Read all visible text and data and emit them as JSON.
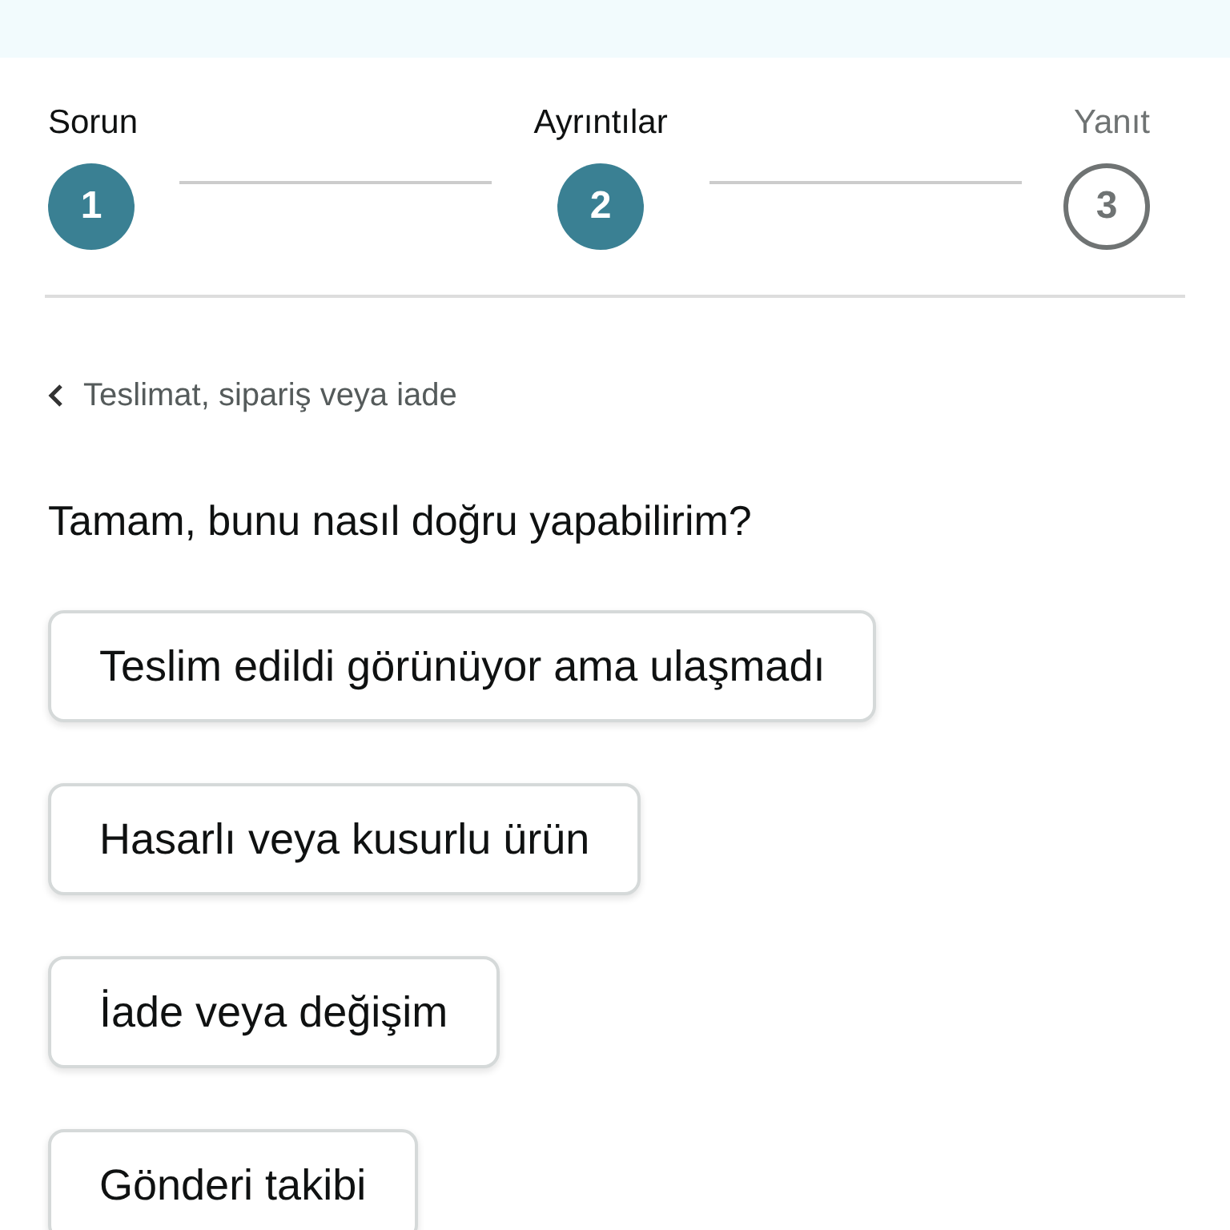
{
  "steps": [
    {
      "label": "Sorun",
      "number": "1",
      "active": true
    },
    {
      "label": "Ayrıntılar",
      "number": "2",
      "active": true
    },
    {
      "label": "Yanıt",
      "number": "3",
      "active": false
    }
  ],
  "back_link": {
    "label": "Teslimat, sipariş veya iade"
  },
  "question": "Tamam, bunu nasıl doğru yapabilirim?",
  "options": [
    {
      "label": "Teslim edildi görünüyor ama ulaşmadı"
    },
    {
      "label": "Hasarlı veya kusurlu ürün"
    },
    {
      "label": "İade veya değişim"
    },
    {
      "label": "Gönderi takibi"
    }
  ]
}
